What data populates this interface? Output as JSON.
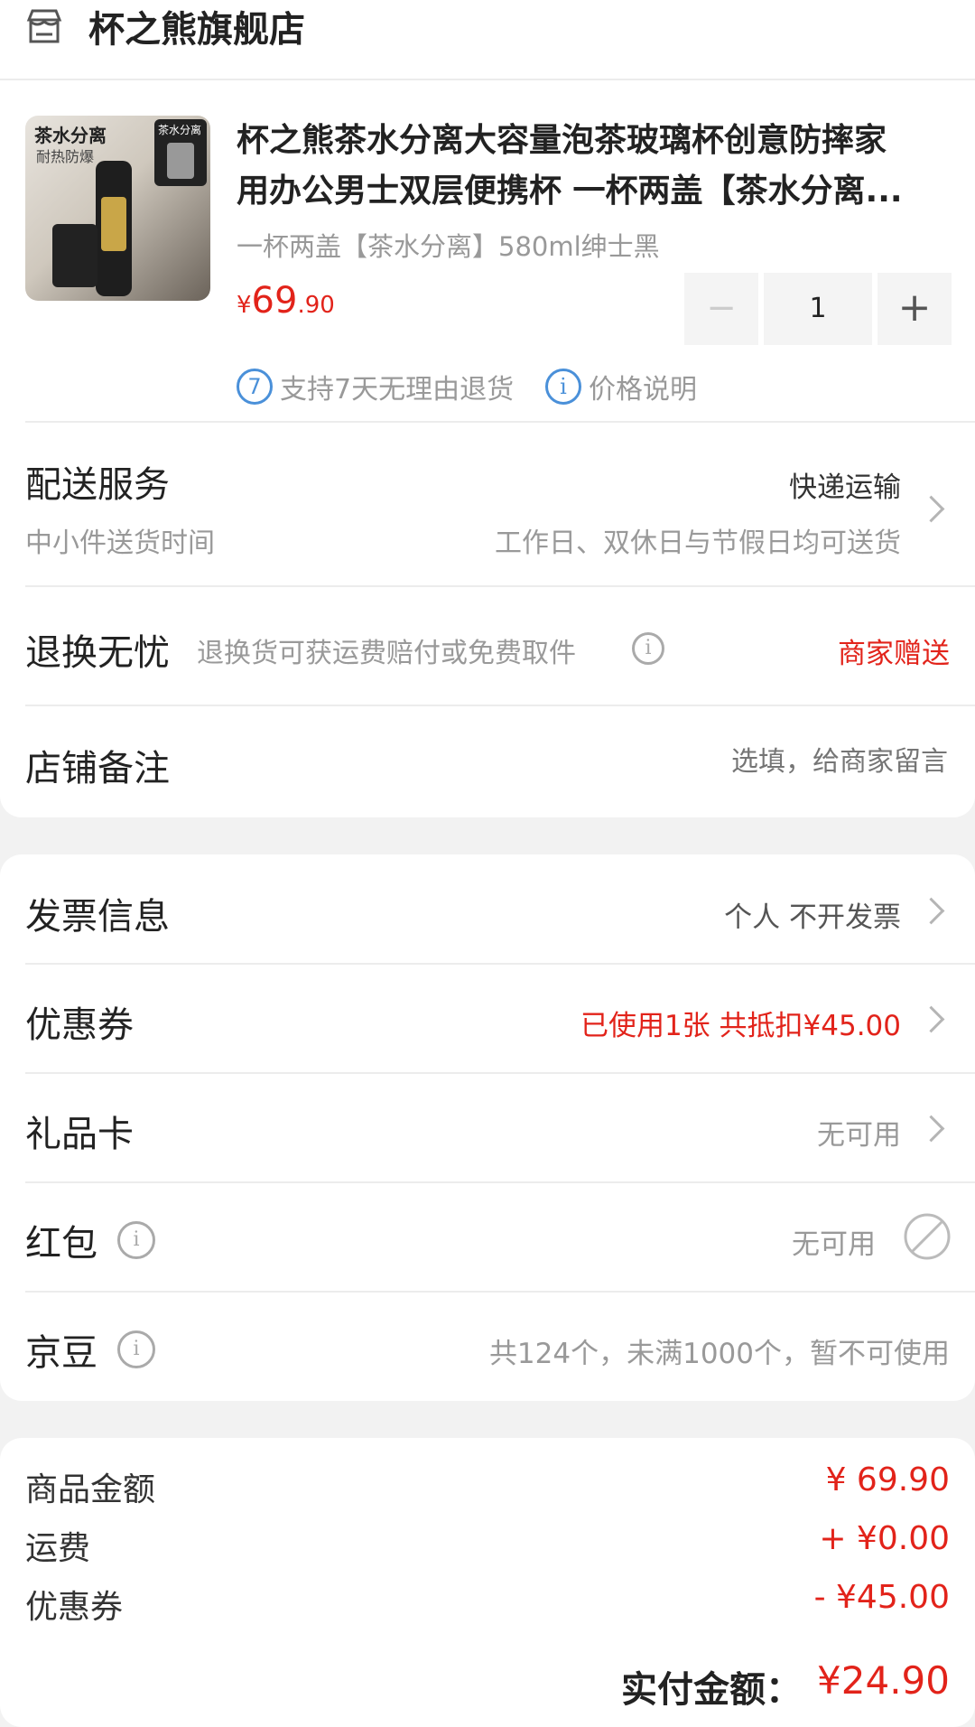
{
  "store": {
    "name": "杯之熊旗舰店",
    "icon": "store-icon"
  },
  "product": {
    "image_label_main": "茶水分离",
    "image_label_sub": "耐热防爆",
    "image_label_corner": "茶水分离",
    "title_line1": "杯之熊茶水分离大容量泡茶玻璃杯创意防摔家",
    "title_line2": "用办公男士双层便携杯 一杯两盖【茶水分离...",
    "variant": "一杯两盖【茶水分离】580ml绅士黑",
    "price_symbol": "¥",
    "price_int": "69",
    "price_dec": ".90",
    "quantity": "1",
    "minus": "−",
    "plus": "+",
    "return_badge": "7",
    "return_text": "支持7天无理由退货",
    "price_info_badge": "i",
    "price_info_text": "价格说明"
  },
  "delivery": {
    "label": "配送服务",
    "sub_label": "中小件送货时间",
    "method": "快递运输",
    "time": "工作日、双休日与节假日均可送货"
  },
  "return_worry": {
    "label": "退换无忧",
    "desc": "退换货可获运费赔付或免费取件",
    "info": "i",
    "value": "商家赠送"
  },
  "remark": {
    "label": "店铺备注",
    "placeholder": "选填，给商家留言"
  },
  "invoice": {
    "label": "发票信息",
    "value": "个人 不开发票"
  },
  "coupon": {
    "label": "优惠券",
    "value": "已使用1张 共抵扣¥45.00"
  },
  "gift_card": {
    "label": "礼品卡",
    "value": "无可用"
  },
  "red_packet": {
    "label": "红包",
    "info": "i",
    "value": "无可用"
  },
  "jingdou": {
    "label": "京豆",
    "info": "i",
    "value": "共124个，未满1000个，暂不可使用"
  },
  "summary": {
    "items": [
      {
        "label": "商品金额",
        "value": "¥ 69.90"
      },
      {
        "label": "运费",
        "value": "+ ¥0.00"
      },
      {
        "label": "优惠券",
        "value": "- ¥45.00"
      }
    ],
    "total_label": "实付金额：",
    "total_value": "¥24.90"
  },
  "colors": {
    "accent": "#e2231a",
    "blue": "#4a90d9"
  }
}
